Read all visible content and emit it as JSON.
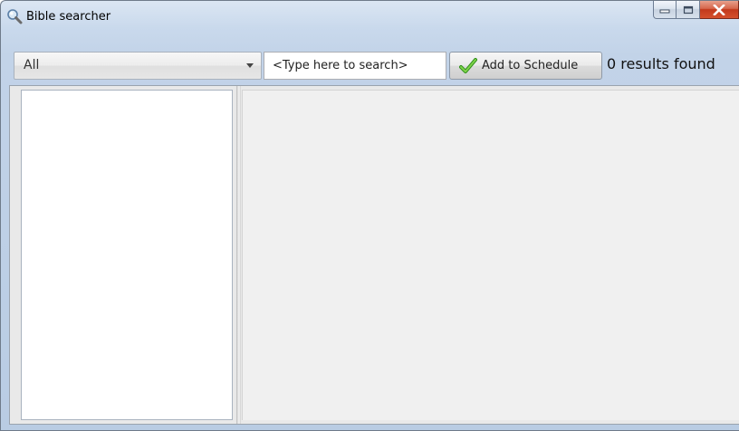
{
  "window": {
    "title": "Bible searcher",
    "title_icon": "magnifier-icon",
    "caption_buttons": {
      "minimize_icon": "minimize-icon",
      "maximize_icon": "maximize-icon",
      "close_icon": "close-icon",
      "close_color": "#c2391c"
    }
  },
  "toolbar": {
    "filter_selected": "All",
    "search": {
      "value": "",
      "placeholder": "<Type here to search>"
    },
    "add_button": {
      "label": "Add to Schedule",
      "icon": "checkmark-icon",
      "icon_color": "#4caf2a"
    },
    "results_text": "0 results found"
  },
  "panes": {
    "left_list_items": [],
    "right_pane_content": ""
  }
}
